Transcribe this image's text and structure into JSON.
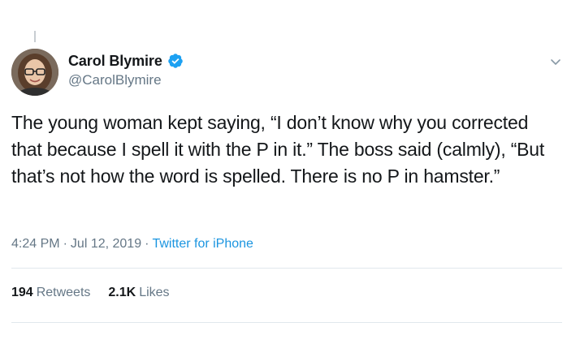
{
  "author": {
    "display_name": "Carol Blymire",
    "handle": "@CarolBlymire",
    "verified": true
  },
  "tweet": {
    "text": "The young woman kept saying, “I don’t know why you corrected that because I spell it with the P in it.” The boss said (calmly), “But that’s not how the word is spelled. There is no P in hamster.”",
    "time": "4:24 PM",
    "separator": "·",
    "date": "Jul 12, 2019",
    "source": "Twitter for iPhone"
  },
  "stats": {
    "retweets_count": "194",
    "retweets_label": "Retweets",
    "likes_count": "2.1K",
    "likes_label": "Likes"
  },
  "icons": {
    "verified": "verified-badge-icon",
    "menu": "chevron-down-icon"
  },
  "colors": {
    "text_primary": "#14171a",
    "text_secondary": "#657786",
    "link": "#1b95e0",
    "verified": "#1da1f2",
    "divider": "#e1e8ed"
  }
}
